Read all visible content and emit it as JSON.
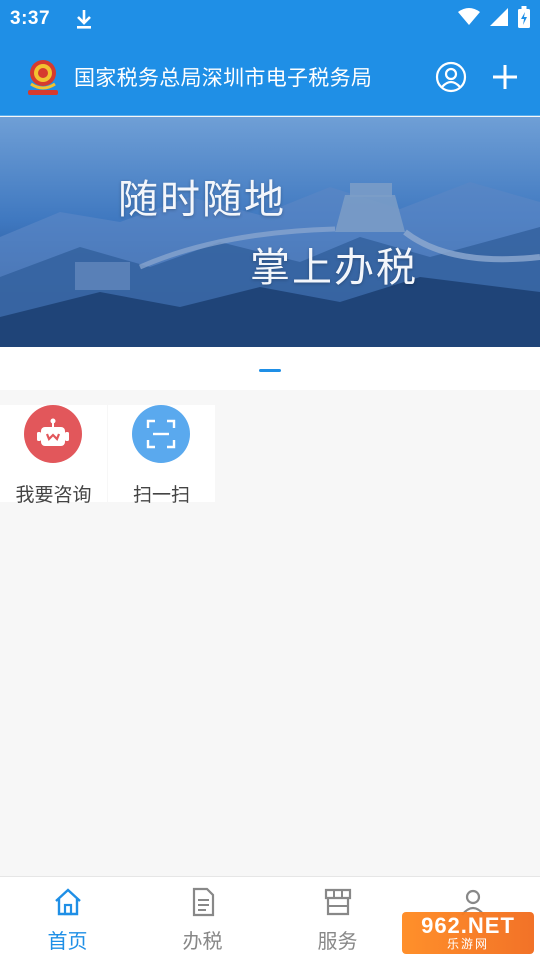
{
  "status_bar": {
    "time": "3:37",
    "icons": [
      "download-icon",
      "wifi-icon",
      "signal-icon",
      "battery-icon"
    ]
  },
  "header": {
    "title": "国家税务总局深圳市电子税务局",
    "actions": [
      "user-icon",
      "plus-icon"
    ]
  },
  "banner": {
    "line1": "随时随地",
    "line2": "掌上办税"
  },
  "quick_actions": [
    {
      "label": "我要咨询",
      "icon": "robot-icon",
      "color": "#e2575b"
    },
    {
      "label": "扫一扫",
      "icon": "scan-icon",
      "color": "#5aa9ee"
    }
  ],
  "bottom_nav": [
    {
      "label": "首页",
      "icon": "home-icon",
      "active": true
    },
    {
      "label": "办税",
      "icon": "document-icon",
      "active": false
    },
    {
      "label": "服务",
      "icon": "store-icon",
      "active": false
    },
    {
      "label": "",
      "icon": "user-icon",
      "active": false
    }
  ],
  "watermark": {
    "top": "962.NET",
    "bottom": "乐游网"
  },
  "colors": {
    "primary": "#1f8fe6",
    "consult": "#e2575b",
    "scan": "#5aa9ee",
    "background": "#f7f7f7"
  }
}
